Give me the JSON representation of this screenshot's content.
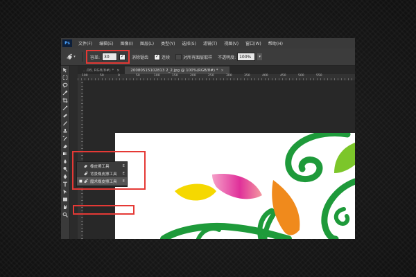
{
  "menubar": {
    "logo": "Ps",
    "items": [
      "文件(F)",
      "编辑(E)",
      "图像(I)",
      "图层(L)",
      "类型(Y)",
      "选择(S)",
      "滤镜(T)",
      "视图(V)",
      "窗口(W)",
      "帮助(H)"
    ]
  },
  "options": {
    "tolerance_label": "容差:",
    "tolerance_value": "30",
    "antialias_label": "消除锯齿",
    "antialias_checked": true,
    "contiguous_label": "连续",
    "contiguous_checked": true,
    "sample_all_label": "对所有图层取样",
    "sample_all_checked": false,
    "opacity_label": "不透明度:",
    "opacity_value": "100%"
  },
  "tabs": [
    {
      "label": "...08, RGB/8#) *",
      "active": false
    },
    {
      "label": "20080515102813 2_2.jpg @ 100%(RGB/8#) *",
      "active": true
    }
  ],
  "ruler": {
    "top_numbers": [
      "100",
      "50",
      "0",
      "50",
      "100",
      "150",
      "200",
      "250",
      "300",
      "350",
      "400",
      "450",
      "500",
      "550"
    ]
  },
  "flyout": {
    "items": [
      {
        "label": "橡皮擦工具",
        "shortcut": "E",
        "selected": false
      },
      {
        "label": "背景橡皮擦工具",
        "shortcut": "E",
        "selected": false
      },
      {
        "label": "魔术橡皮擦工具",
        "shortcut": "E",
        "selected": true
      }
    ]
  },
  "icons": {
    "tools": [
      "move-icon",
      "marquee-icon",
      "lasso-icon",
      "quick-select-icon",
      "crop-icon",
      "eyedropper-icon",
      "healing-icon",
      "brush-icon",
      "stamp-icon",
      "history-brush-icon",
      "eraser-icon",
      "gradient-icon",
      "blur-icon",
      "dodge-icon",
      "pen-icon",
      "type-icon",
      "path-select-icon",
      "shape-icon",
      "hand-icon",
      "zoom-icon"
    ]
  },
  "colors": {
    "highlight": "#e53935",
    "leaf_green": "#1e9a3a",
    "leaf_yellow": "#f5d800",
    "leaf_orange": "#f08a1c",
    "leaf_magenta": "#e0309a",
    "leaf_lime": "#7cc62a"
  }
}
